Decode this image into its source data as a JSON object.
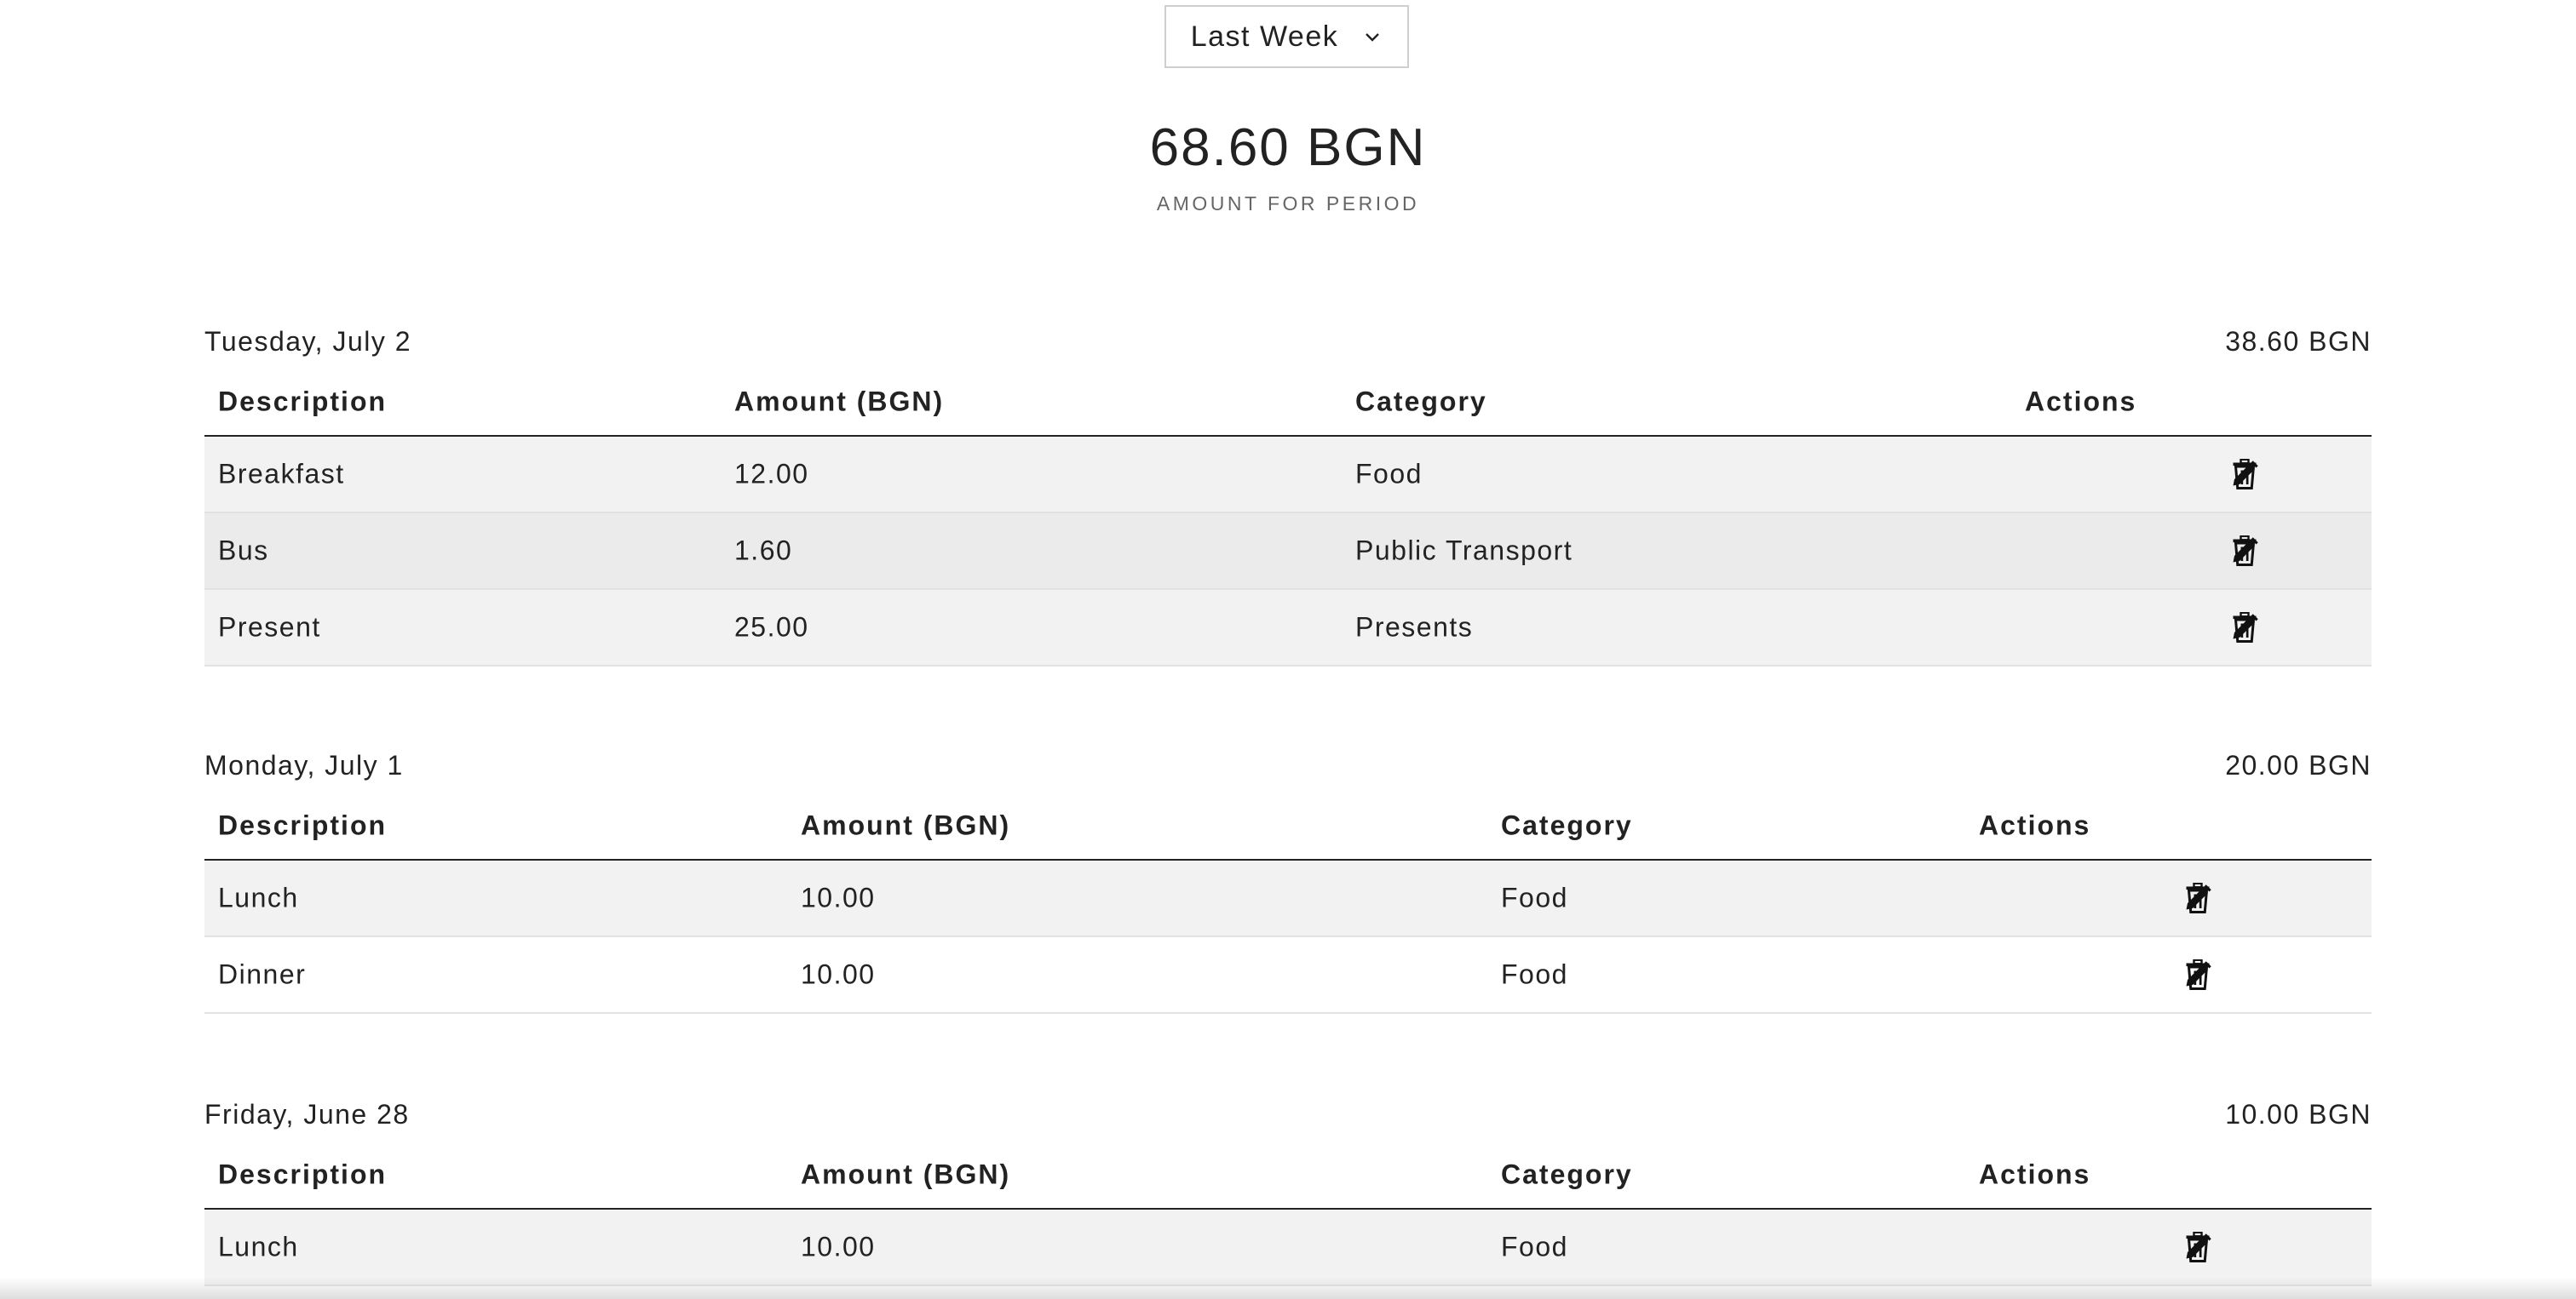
{
  "period": {
    "selected": "Last Week"
  },
  "summary": {
    "amount": "68.60 BGN",
    "label": "AMOUNT FOR PERIOD"
  },
  "columns": {
    "description": "Description",
    "amount": "Amount (BGN)",
    "category": "Category",
    "actions": "Actions"
  },
  "days": [
    {
      "title": "Tuesday, July 2",
      "total": "38.60 BGN",
      "rows": [
        {
          "description": "Breakfast",
          "amount": "12.00",
          "category": "Food"
        },
        {
          "description": "Bus",
          "amount": "1.60",
          "category": "Public Transport"
        },
        {
          "description": "Present",
          "amount": "25.00",
          "category": "Presents"
        }
      ]
    },
    {
      "title": "Monday, July 1",
      "total": "20.00 BGN",
      "rows": [
        {
          "description": "Lunch",
          "amount": "10.00",
          "category": "Food"
        },
        {
          "description": "Dinner",
          "amount": "10.00",
          "category": "Food"
        }
      ]
    },
    {
      "title": "Friday, June 28",
      "total": "10.00 BGN",
      "rows": [
        {
          "description": "Lunch",
          "amount": "10.00",
          "category": "Food"
        }
      ]
    }
  ],
  "icons": {
    "edit": "pencil-icon",
    "delete": "trash-icon",
    "dropdown": "chevron-down-icon"
  }
}
